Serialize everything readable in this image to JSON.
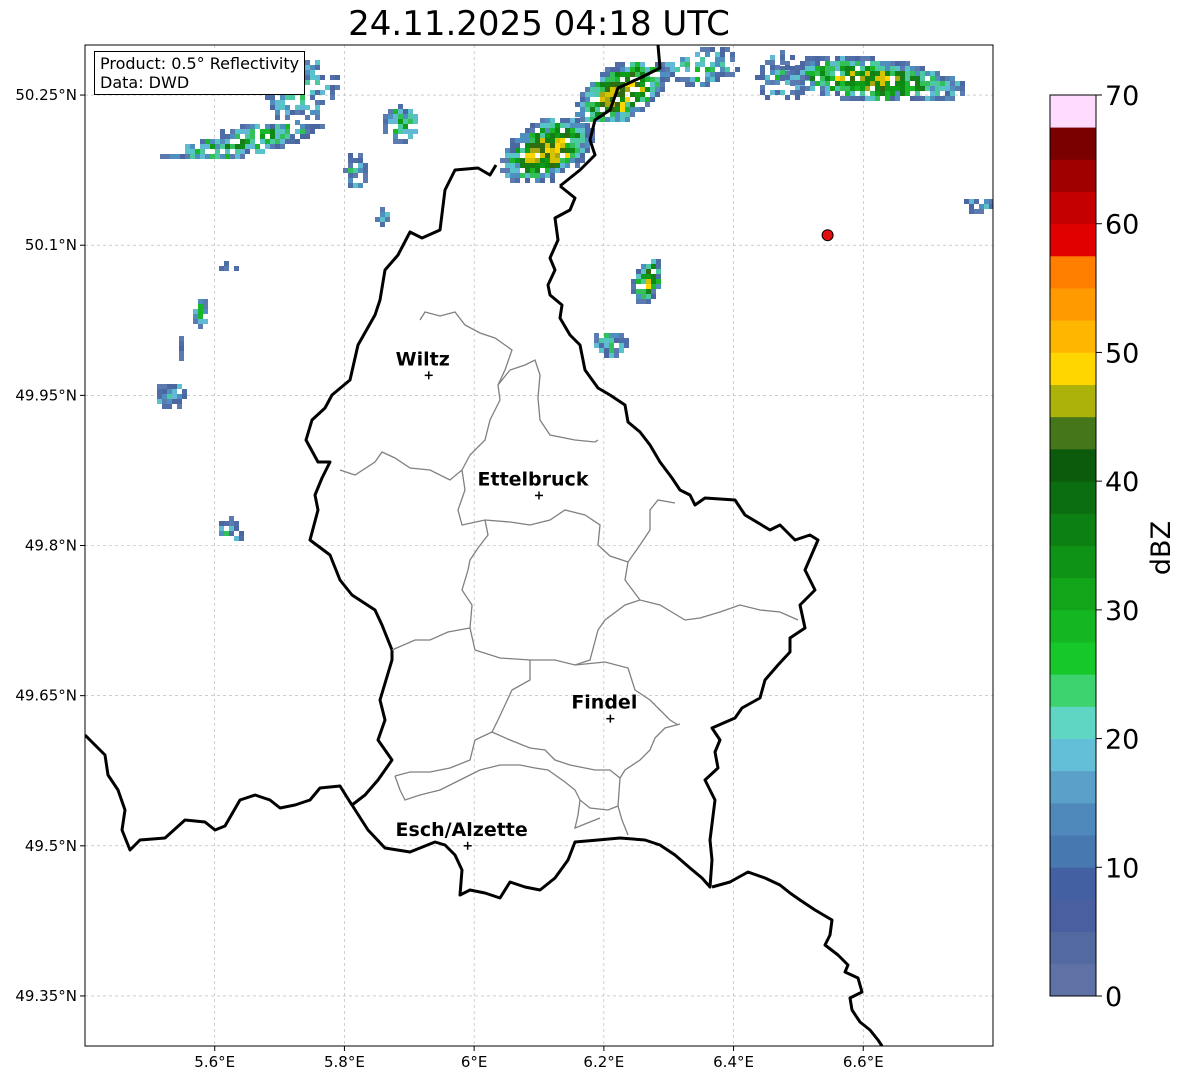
{
  "title": "24.11.2025 04:18 UTC",
  "info": {
    "product": "Product: 0.5° Reflectivity",
    "source": "Data: DWD"
  },
  "colorbar": {
    "label": "dBZ",
    "ticks": [
      "0",
      "10",
      "20",
      "30",
      "40",
      "50",
      "60",
      "70"
    ],
    "min": 0,
    "max": 70,
    "step": 2.5,
    "colors": [
      "#6071a6",
      "#536aa0",
      "#4a5f9f",
      "#4361a2",
      "#4878b0",
      "#4f88bb",
      "#5aa0c9",
      "#63bfd8",
      "#5fd6c4",
      "#3dd36e",
      "#17c82a",
      "#14b721",
      "#12a51a",
      "#0f9316",
      "#0c8012",
      "#0a6d0f",
      "#0c5a0c",
      "#45771a",
      "#adb20a",
      "#ffd600",
      "#ffb600",
      "#ff9b00",
      "#ff7e00",
      "#e00000",
      "#c40000",
      "#a00000",
      "#7a0000",
      "#ffdcff",
      "#ffb0ff",
      "#ff6cff",
      "#ea3cea"
    ]
  },
  "axes": {
    "lon_ticks": [
      "5.6°E",
      "5.8°E",
      "6°E",
      "6.2°E",
      "6.4°E",
      "6.6°E"
    ],
    "lat_ticks": [
      "50.25°N",
      "50.1°N",
      "49.95°N",
      "49.8°N",
      "49.65°N",
      "49.5°N",
      "49.35°N"
    ],
    "extent": {
      "lon_min": 5.4,
      "lon_max": 6.8,
      "lat_min": 49.3,
      "lat_max": 50.3
    },
    "grid": true
  },
  "cities": [
    {
      "name": "Wiltz",
      "lon": 5.93,
      "lat": 49.97
    },
    {
      "name": "Ettelbruck",
      "lon": 6.1,
      "lat": 49.85
    },
    {
      "name": "Findel",
      "lon": 6.21,
      "lat": 49.627
    },
    {
      "name": "Esch/Alzette",
      "lon": 5.99,
      "lat": 49.5
    }
  ],
  "marker": {
    "lon": 6.545,
    "lat": 50.11,
    "color": "#e01010"
  },
  "border_color": "#000000",
  "canton_color": "#808080"
}
